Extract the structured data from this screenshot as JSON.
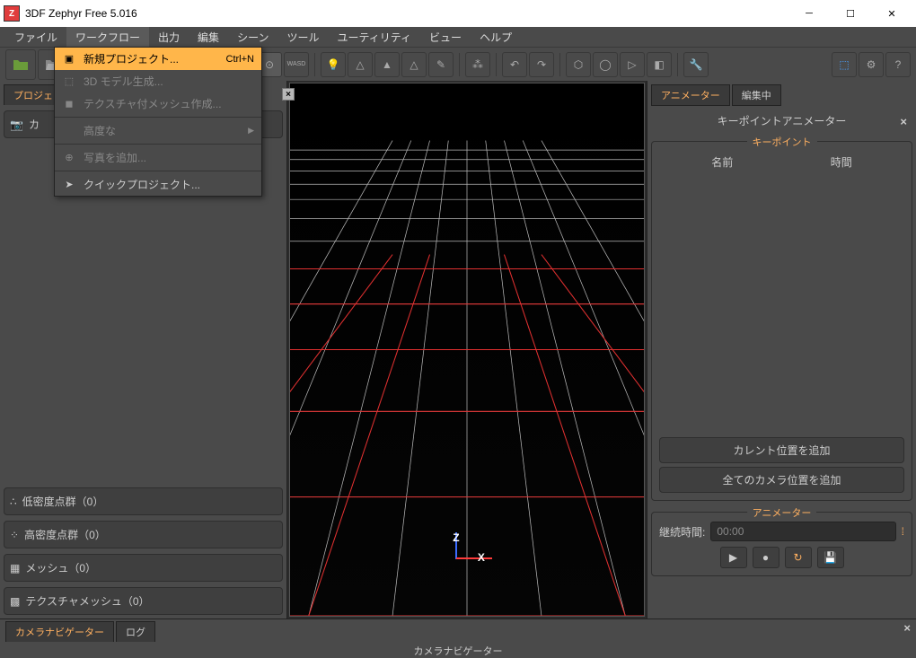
{
  "app": {
    "title": "3DF Zephyr Free 5.016"
  },
  "menubar": [
    "ファイル",
    "ワークフロー",
    "出力",
    "編集",
    "シーン",
    "ツール",
    "ユーティリティ",
    "ビュー",
    "ヘルプ"
  ],
  "dropdown": {
    "new_project": "新規プロジェクト...",
    "shortcut": "Ctrl+N",
    "gen_3d": "3D モデル生成...",
    "tex_mesh": "テクスチャ付メッシュ作成...",
    "advanced": "高度な",
    "add_photo": "写真を追加...",
    "quick": "クイックプロジェクト..."
  },
  "left": {
    "tab": "プロジェ",
    "low_density": "低密度点群（0）",
    "high_density": "高密度点群（0）",
    "mesh": "メッシュ（0）",
    "tex_mesh": "テクスチャメッシュ（0）",
    "camera_btn": "カ"
  },
  "viewport": {
    "z": "Z",
    "x": "X"
  },
  "right": {
    "tab_animator": "アニメーター",
    "tab_editing": "編集中",
    "title": "キーポイントアニメーター",
    "keypoint_legend": "キーポイント",
    "col_name": "名前",
    "col_time": "時間",
    "btn_add_current": "カレント位置を追加",
    "btn_add_all": "全てのカメラ位置を追加",
    "animator_legend": "アニメーター",
    "duration_label": "継続時間:",
    "duration_value": "00:00"
  },
  "bottom": {
    "tab_nav": "カメラナビゲーター",
    "tab_log": "ログ",
    "title": "カメラナビゲーター"
  }
}
